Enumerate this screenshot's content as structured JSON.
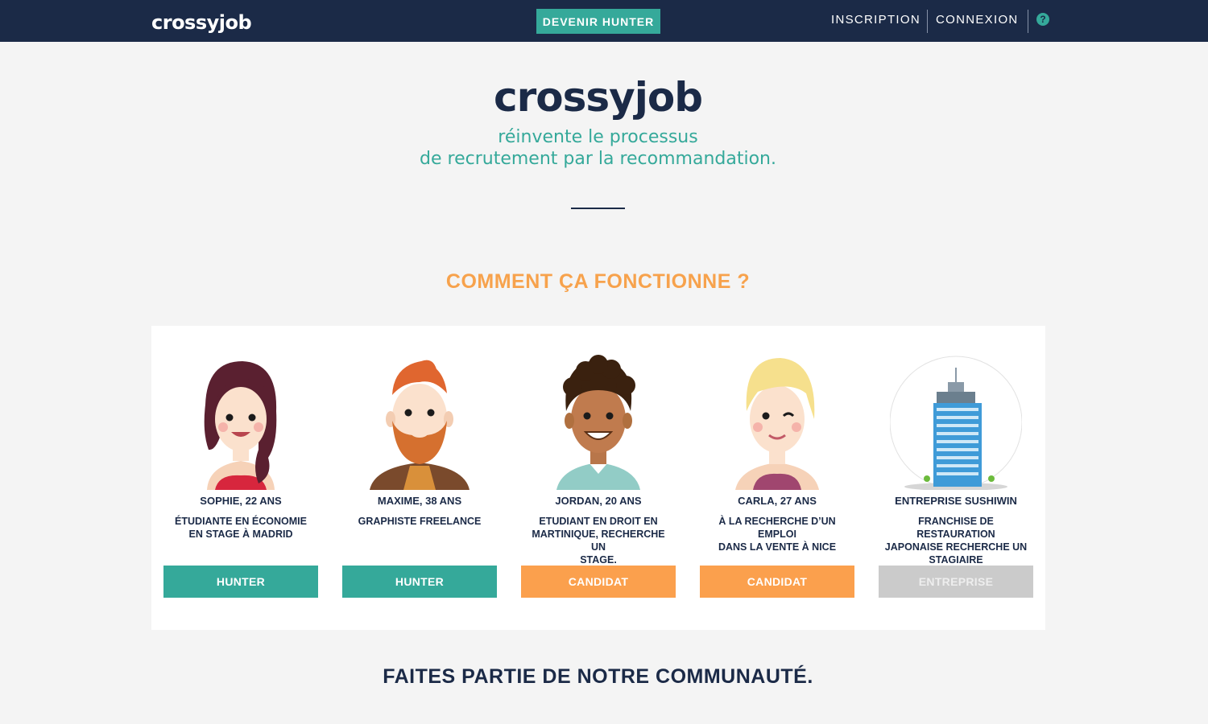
{
  "navbar": {
    "logo": "crossyjob",
    "cta": "DEVENIR HUNTER",
    "links": [
      "INSCRIPTION",
      "CONNEXION"
    ],
    "help_icon": "question-circle-icon"
  },
  "hero": {
    "logo": "crossyjob",
    "tagline_line1": "réinvente le processus",
    "tagline_line2": "de recrutement par la recommandation."
  },
  "how_it_works": {
    "title": "COMMENT ÇA FONCTIONNE ?",
    "personas": [
      {
        "name": "SOPHIE, 22 ANS",
        "desc_lines": [
          "ÉTUDIANTE EN ÉCONOMIE",
          "EN STAGE À MADRID"
        ],
        "button": "HUNTER",
        "avatar_icon": "woman-dark-hair-avatar"
      },
      {
        "name": "MAXIME, 38 ANS",
        "desc_lines": [
          "GRAPHISTE FREELANCE"
        ],
        "button": "HUNTER",
        "avatar_icon": "bearded-man-avatar"
      },
      {
        "name": "JORDAN, 20 ANS",
        "desc_lines": [
          "ETUDIANT EN DROIT EN",
          "MARTINIQUE, RECHERCHE UN",
          "STAGE."
        ],
        "button": "CANDIDAT",
        "avatar_icon": "curly-hair-man-avatar"
      },
      {
        "name": "CARLA, 27 ANS",
        "desc_lines": [
          "À LA RECHERCHE D’UN EMPLOI",
          "DANS LA VENTE À NICE"
        ],
        "button": "CANDIDAT",
        "avatar_icon": "blonde-woman-avatar"
      },
      {
        "name": "ENTREPRISE SUSHIWIN",
        "desc_lines": [
          "FRANCHISE DE RESTAURATION",
          "JAPONAISE RECHERCHE UN",
          "STAGIAIRE"
        ],
        "button": "ENTREPRISE",
        "avatar_icon": "office-building-avatar"
      }
    ]
  },
  "community_title": "FAITES PARTIE DE NOTRE COMMUNAUTÉ.",
  "colors": {
    "navy": "#1b2a47",
    "teal": "#35a99a",
    "orange": "#fba04d",
    "grey_button": "#cbcbcb"
  }
}
